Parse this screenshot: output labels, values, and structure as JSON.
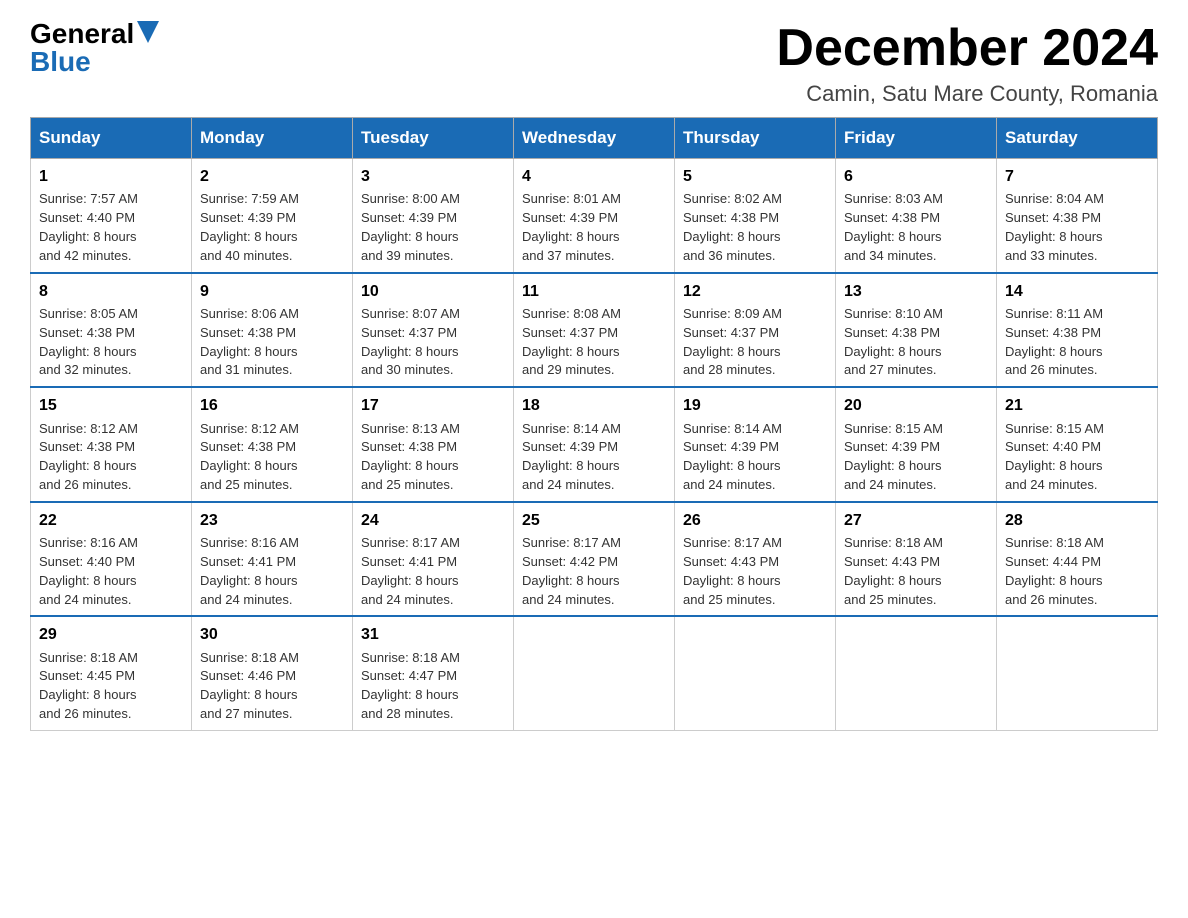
{
  "header": {
    "logo_general": "General",
    "logo_blue": "Blue",
    "month_title": "December 2024",
    "location": "Camin, Satu Mare County, Romania"
  },
  "columns": [
    "Sunday",
    "Monday",
    "Tuesday",
    "Wednesday",
    "Thursday",
    "Friday",
    "Saturday"
  ],
  "weeks": [
    [
      {
        "day": "1",
        "sunrise": "7:57 AM",
        "sunset": "4:40 PM",
        "daylight": "8 hours and 42 minutes."
      },
      {
        "day": "2",
        "sunrise": "7:59 AM",
        "sunset": "4:39 PM",
        "daylight": "8 hours and 40 minutes."
      },
      {
        "day": "3",
        "sunrise": "8:00 AM",
        "sunset": "4:39 PM",
        "daylight": "8 hours and 39 minutes."
      },
      {
        "day": "4",
        "sunrise": "8:01 AM",
        "sunset": "4:39 PM",
        "daylight": "8 hours and 37 minutes."
      },
      {
        "day": "5",
        "sunrise": "8:02 AM",
        "sunset": "4:38 PM",
        "daylight": "8 hours and 36 minutes."
      },
      {
        "day": "6",
        "sunrise": "8:03 AM",
        "sunset": "4:38 PM",
        "daylight": "8 hours and 34 minutes."
      },
      {
        "day": "7",
        "sunrise": "8:04 AM",
        "sunset": "4:38 PM",
        "daylight": "8 hours and 33 minutes."
      }
    ],
    [
      {
        "day": "8",
        "sunrise": "8:05 AM",
        "sunset": "4:38 PM",
        "daylight": "8 hours and 32 minutes."
      },
      {
        "day": "9",
        "sunrise": "8:06 AM",
        "sunset": "4:38 PM",
        "daylight": "8 hours and 31 minutes."
      },
      {
        "day": "10",
        "sunrise": "8:07 AM",
        "sunset": "4:37 PM",
        "daylight": "8 hours and 30 minutes."
      },
      {
        "day": "11",
        "sunrise": "8:08 AM",
        "sunset": "4:37 PM",
        "daylight": "8 hours and 29 minutes."
      },
      {
        "day": "12",
        "sunrise": "8:09 AM",
        "sunset": "4:37 PM",
        "daylight": "8 hours and 28 minutes."
      },
      {
        "day": "13",
        "sunrise": "8:10 AM",
        "sunset": "4:38 PM",
        "daylight": "8 hours and 27 minutes."
      },
      {
        "day": "14",
        "sunrise": "8:11 AM",
        "sunset": "4:38 PM",
        "daylight": "8 hours and 26 minutes."
      }
    ],
    [
      {
        "day": "15",
        "sunrise": "8:12 AM",
        "sunset": "4:38 PM",
        "daylight": "8 hours and 26 minutes."
      },
      {
        "day": "16",
        "sunrise": "8:12 AM",
        "sunset": "4:38 PM",
        "daylight": "8 hours and 25 minutes."
      },
      {
        "day": "17",
        "sunrise": "8:13 AM",
        "sunset": "4:38 PM",
        "daylight": "8 hours and 25 minutes."
      },
      {
        "day": "18",
        "sunrise": "8:14 AM",
        "sunset": "4:39 PM",
        "daylight": "8 hours and 24 minutes."
      },
      {
        "day": "19",
        "sunrise": "8:14 AM",
        "sunset": "4:39 PM",
        "daylight": "8 hours and 24 minutes."
      },
      {
        "day": "20",
        "sunrise": "8:15 AM",
        "sunset": "4:39 PM",
        "daylight": "8 hours and 24 minutes."
      },
      {
        "day": "21",
        "sunrise": "8:15 AM",
        "sunset": "4:40 PM",
        "daylight": "8 hours and 24 minutes."
      }
    ],
    [
      {
        "day": "22",
        "sunrise": "8:16 AM",
        "sunset": "4:40 PM",
        "daylight": "8 hours and 24 minutes."
      },
      {
        "day": "23",
        "sunrise": "8:16 AM",
        "sunset": "4:41 PM",
        "daylight": "8 hours and 24 minutes."
      },
      {
        "day": "24",
        "sunrise": "8:17 AM",
        "sunset": "4:41 PM",
        "daylight": "8 hours and 24 minutes."
      },
      {
        "day": "25",
        "sunrise": "8:17 AM",
        "sunset": "4:42 PM",
        "daylight": "8 hours and 24 minutes."
      },
      {
        "day": "26",
        "sunrise": "8:17 AM",
        "sunset": "4:43 PM",
        "daylight": "8 hours and 25 minutes."
      },
      {
        "day": "27",
        "sunrise": "8:18 AM",
        "sunset": "4:43 PM",
        "daylight": "8 hours and 25 minutes."
      },
      {
        "day": "28",
        "sunrise": "8:18 AM",
        "sunset": "4:44 PM",
        "daylight": "8 hours and 26 minutes."
      }
    ],
    [
      {
        "day": "29",
        "sunrise": "8:18 AM",
        "sunset": "4:45 PM",
        "daylight": "8 hours and 26 minutes."
      },
      {
        "day": "30",
        "sunrise": "8:18 AM",
        "sunset": "4:46 PM",
        "daylight": "8 hours and 27 minutes."
      },
      {
        "day": "31",
        "sunrise": "8:18 AM",
        "sunset": "4:47 PM",
        "daylight": "8 hours and 28 minutes."
      },
      null,
      null,
      null,
      null
    ]
  ],
  "labels": {
    "sunrise": "Sunrise:",
    "sunset": "Sunset:",
    "daylight": "Daylight:"
  }
}
